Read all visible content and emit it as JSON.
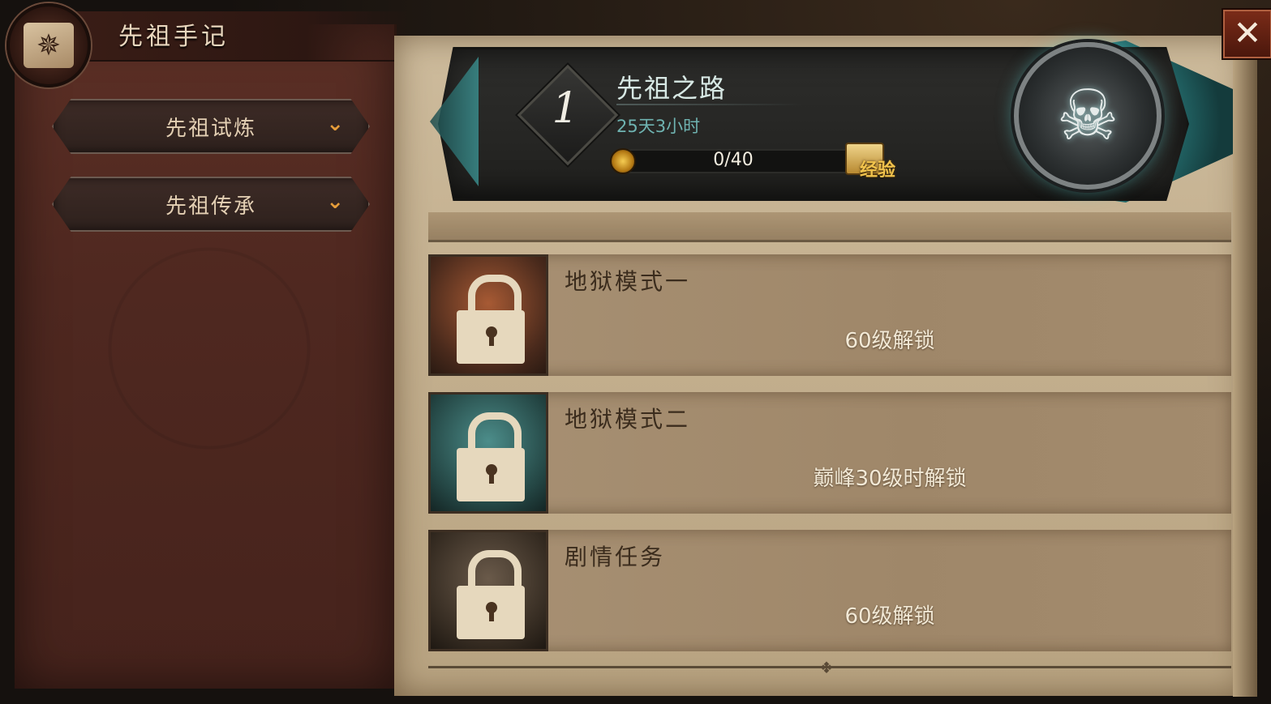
{
  "sidebar": {
    "title": "先祖手记",
    "badge_icon": "✵",
    "dropdowns": [
      {
        "label": "先祖试炼",
        "chevron": "⌄"
      },
      {
        "label": "先祖传承",
        "chevron": "⌄"
      }
    ]
  },
  "header": {
    "level": "1",
    "title": "先祖之路",
    "time_left": "25天3小时",
    "progress_text": "0/40",
    "progress_fraction": 0,
    "reward_label": "经验",
    "emblem_icon": "☠"
  },
  "close_icon": "✕",
  "levels": [
    {
      "name": "地狱模式一",
      "unlock": "60级解锁",
      "theme": "t1"
    },
    {
      "name": "地狱模式二",
      "unlock": "巅峰30级时解锁",
      "theme": "t2"
    },
    {
      "name": "剧情任务",
      "unlock": "60级解锁",
      "theme": "t3"
    }
  ],
  "colors": {
    "accent_gold": "#e0a33a",
    "teal": "#4ab8b8",
    "parchment": "#c2ae8d",
    "sidebar_red": "#4f2820"
  }
}
